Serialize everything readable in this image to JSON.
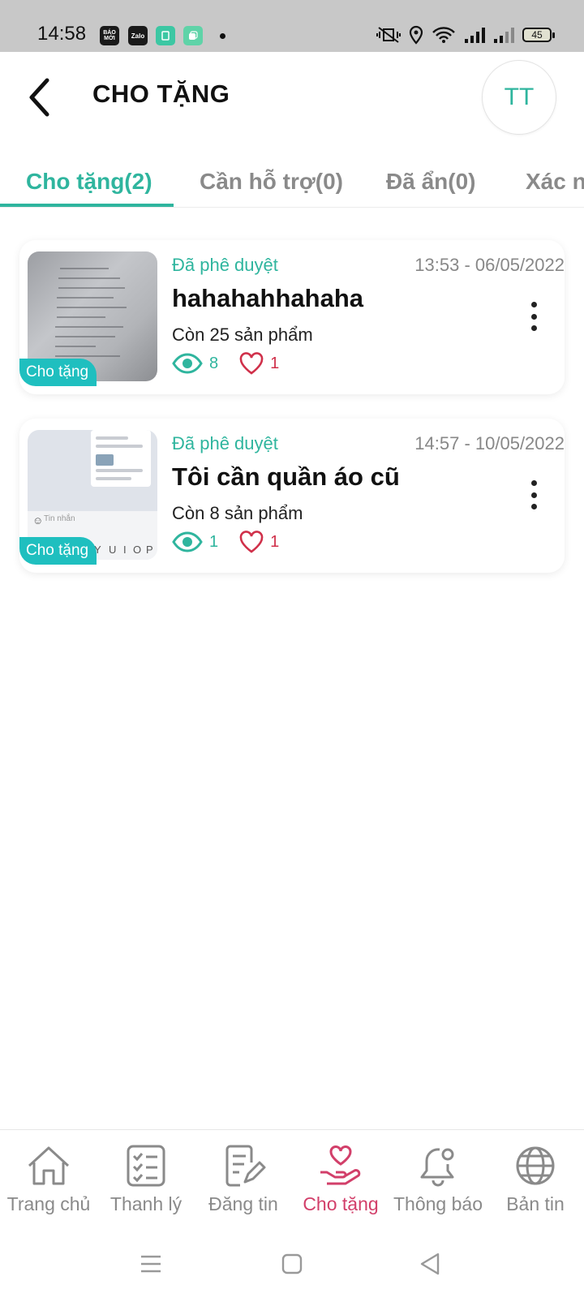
{
  "status_bar": {
    "time": "14:58",
    "apps": [
      {
        "icon": "bao-moi-icon",
        "label": "BÁO MỚI",
        "color": "#1a1a1a"
      },
      {
        "icon": "zalo-icon",
        "label": "Zalo",
        "color": "#1a1a1a"
      },
      {
        "icon": "app-green-icon",
        "label": "",
        "color": "#3cc7a3"
      },
      {
        "icon": "app-teal-icon",
        "label": "",
        "color": "#5fd3a8"
      }
    ],
    "battery": "45"
  },
  "header": {
    "title": "CHO TẶNG",
    "avatar_initials": "TT"
  },
  "tabs": [
    {
      "label": "Cho tặng(2)",
      "active": true
    },
    {
      "label": "Cần hỗ trợ(0)",
      "active": false
    },
    {
      "label": "Đã ẩn(0)",
      "active": false
    },
    {
      "label": "Xác nhận",
      "active": false
    }
  ],
  "posts": [
    {
      "tag": "Cho tặng",
      "status": "Đã phê duyệt",
      "datetime": "13:53 - 06/05/2022",
      "title": "hahahahhahaha",
      "remaining": "Còn 25 sản phẩm",
      "views": "8",
      "likes": "1"
    },
    {
      "tag": "Cho tặng",
      "status": "Đã phê duyệt",
      "datetime": "14:57 - 10/05/2022",
      "title": "Tôi cần quần áo cũ",
      "remaining": "Còn 8 sản phẩm",
      "views": "1",
      "likes": "1"
    }
  ],
  "bottom_nav": [
    {
      "label": "Trang chủ",
      "icon": "home-icon",
      "active": false
    },
    {
      "label": "Thanh lý",
      "icon": "checklist-icon",
      "active": false
    },
    {
      "label": "Đăng tin",
      "icon": "edit-post-icon",
      "active": false
    },
    {
      "label": "Cho tặng",
      "icon": "heart-hand-icon",
      "active": true
    },
    {
      "label": "Thông báo",
      "icon": "bell-icon",
      "active": false
    },
    {
      "label": "Bản tin",
      "icon": "globe-icon",
      "active": false
    }
  ],
  "colors": {
    "accent": "#2fb59e",
    "active_nav": "#d23f6a",
    "tag": "#1fbfbf",
    "like": "#d0304a"
  }
}
